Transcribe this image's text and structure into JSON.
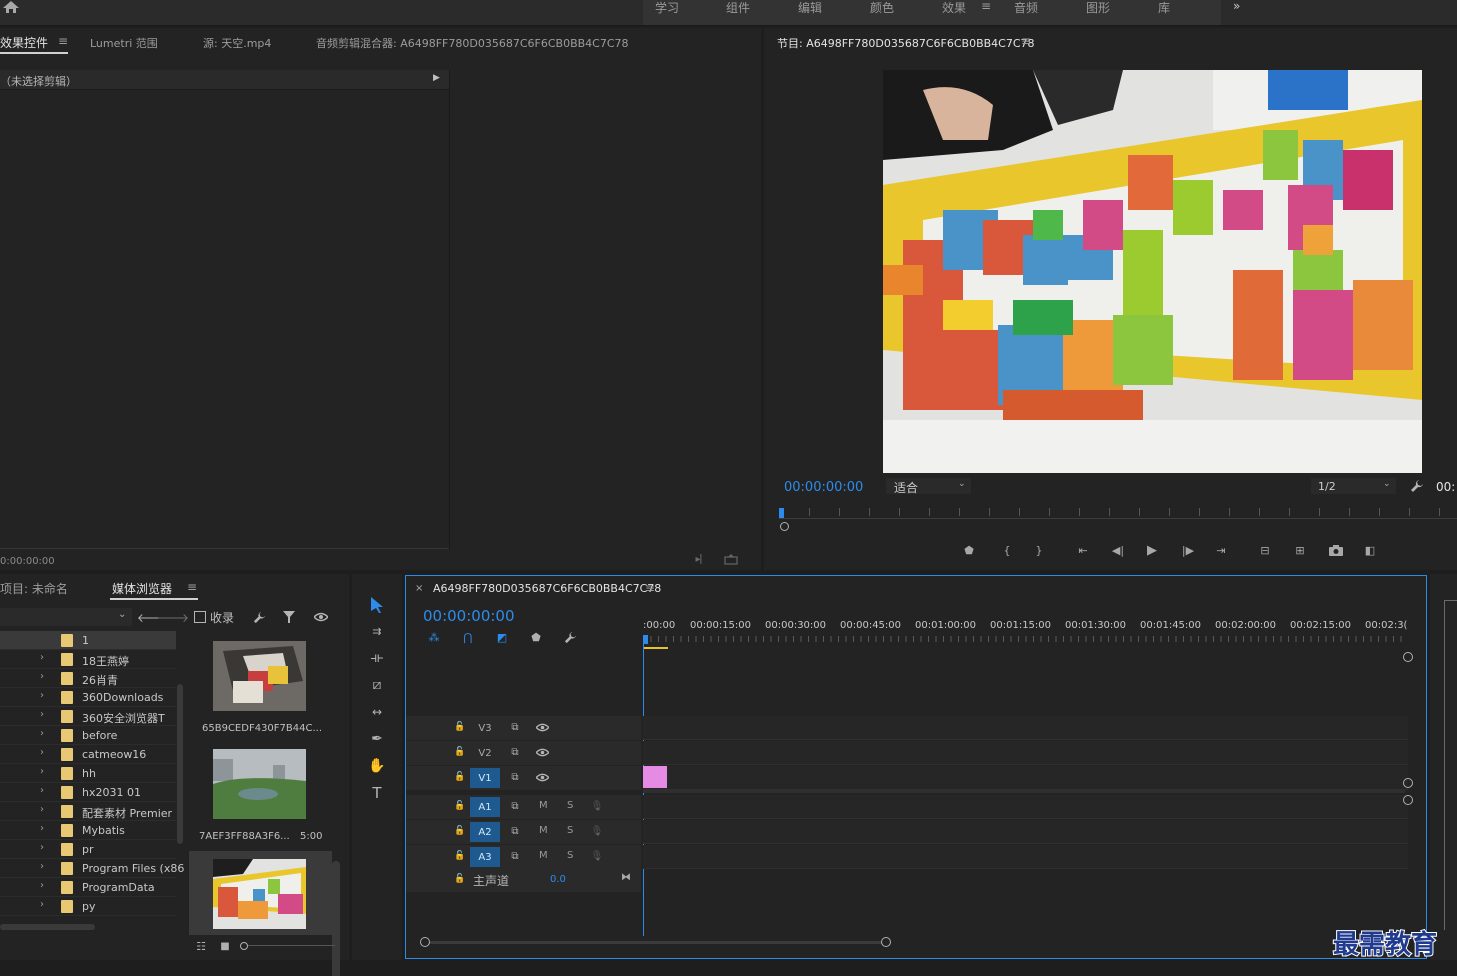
{
  "workspaces": [
    "学习",
    "组件",
    "编辑",
    "颜色",
    "效果",
    "音频",
    "图形",
    "库"
  ],
  "active_workspace": "效果",
  "effect_controls": {
    "tabs": [
      "效果控件",
      "Lumetri 范围",
      "源: 天空.mp4",
      "音频剪辑混合器: A6498FF780D035687C6F6CB0BB4C7C78"
    ],
    "no_clip": "（未选择剪辑）",
    "timecode": "0:00:00:00"
  },
  "program": {
    "title": "节目: A6498FF780D035687C6F6CB0BB4C7C78",
    "timecode": "00:00:00:00",
    "fit": "适合",
    "resolution": "1/2",
    "duration_partial": "00:"
  },
  "project": {
    "tab_project": "项目: 未命名",
    "tab_media": "媒体浏览器",
    "ingest": "收录",
    "folders": [
      "1",
      "18王燕婷",
      "26肖青",
      "360Downloads",
      "360安全浏览器T",
      "before",
      "catmeow16",
      "hh",
      "hx2031 01",
      "配套素材 Premier",
      "Mybatis",
      "pr",
      "Program Files (x86",
      "ProgramData",
      "py"
    ],
    "clip1": "65B9CEDF430F7B44C...",
    "clip2": "7AEF3FF88A3F6...",
    "clip2_duration": "5:00"
  },
  "timeline": {
    "sequence": "A6498FF780D035687C6F6CB0BB4C7C78",
    "timecode": "00:00:00:00",
    "ruler": [
      ":00:00",
      "00:00:15:00",
      "00:00:30:00",
      "00:00:45:00",
      "00:01:00:00",
      "00:01:15:00",
      "00:01:30:00",
      "00:01:45:00",
      "00:02:00:00",
      "00:02:15:00",
      "00:02:3("
    ],
    "video_tracks": [
      "V3",
      "V2",
      "V1"
    ],
    "audio_tracks": [
      "A1",
      "A2",
      "A3"
    ],
    "mute": "M",
    "solo": "S",
    "master": "主声道",
    "master_value": "0.0"
  },
  "watermark": "最需教育",
  "colors": {
    "accent": "#2d8ceb",
    "clip": "#e58be3",
    "folder": "#e8c872"
  }
}
